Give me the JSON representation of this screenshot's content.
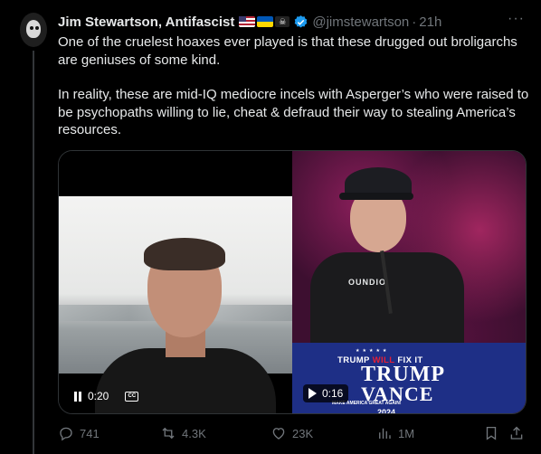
{
  "tweet": {
    "author_name": "Jim Stewartson, Antifascist",
    "flags": [
      "us-flag",
      "ukraine-flag",
      "pirate-flag"
    ],
    "handle": "@jimstewartson",
    "separator": "·",
    "time": "21h",
    "more": "···",
    "text_para1": "One of the cruelest hoaxes ever played is that these drugged out broligarchs are geniuses of some kind.",
    "text_para2": "In reality, these are mid-IQ mediocre incels with Asperger’s who were raised to be psychopaths willing to lie, cheat & defraud their way to stealing America’s resources."
  },
  "media": {
    "left_video": {
      "time": "0:20",
      "state": "playing",
      "cc_label": "CC"
    },
    "right_video": {
      "time": "0:16",
      "state": "paused",
      "shirt_text": "OUNDIO",
      "podium_stars": "★★★★★",
      "podium_line1_a": "TRUMP ",
      "podium_line1_b": "WILL",
      "podium_line1_c": " FIX IT",
      "podium_trump": "TRUMP",
      "podium_vance": "VANCE",
      "podium_maga": "MAKE AMERICA GREAT AGAIN!",
      "podium_year": "2024"
    }
  },
  "actions": {
    "replies": "741",
    "reposts": "4.3K",
    "likes": "23K",
    "views": "1M"
  },
  "colors": {
    "background": "#000000",
    "text": "#e7e9ea",
    "muted": "#71767b",
    "verified": "#1d9bf0",
    "border": "#2f3336"
  }
}
